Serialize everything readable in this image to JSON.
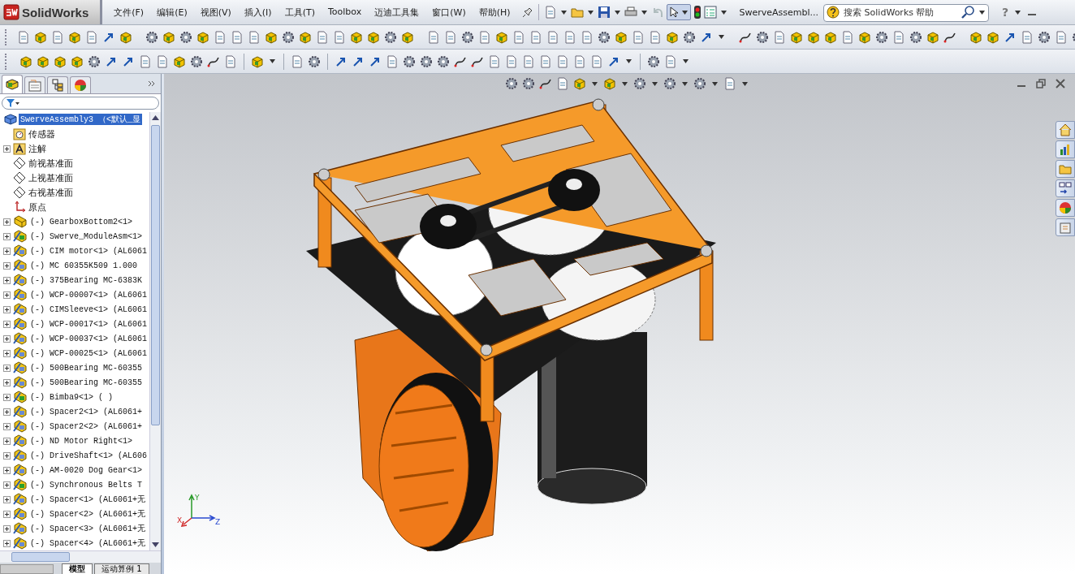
{
  "app": {
    "name": "SolidWorks"
  },
  "menu": [
    "文件(F)",
    "编辑(E)",
    "视图(V)",
    "插入(I)",
    "工具(T)",
    "Toolbox",
    "迈迪工具集",
    "窗口(W)",
    "帮助(H)"
  ],
  "document_title": "SwerveAssembl...",
  "search": {
    "placeholder": "搜索 SolidWorks 帮助"
  },
  "help_button": "?",
  "tree": {
    "root": {
      "label": "SwerveAssembly3 （<默认_显",
      "selected": true
    },
    "items": [
      {
        "label": "传感器",
        "kind": "sensor",
        "expandable": false
      },
      {
        "label": "注解",
        "kind": "annotation",
        "expandable": true
      },
      {
        "label": "前视基准面",
        "kind": "plane",
        "expandable": false
      },
      {
        "label": "上视基准面",
        "kind": "plane",
        "expandable": false
      },
      {
        "label": "右视基准面",
        "kind": "plane",
        "expandable": false
      },
      {
        "label": "原点",
        "kind": "origin",
        "expandable": false
      },
      {
        "label": "(-) GearboxBottom2<1>",
        "kind": "part",
        "expandable": true
      },
      {
        "label": "(-) Swerve_ModuleAsm<1>",
        "kind": "assembly",
        "expandable": true
      },
      {
        "label": "(-) CIM motor<1> (AL6061",
        "kind": "subpart",
        "expandable": true
      },
      {
        "label": "(-) MC 60355K509 1.000",
        "kind": "subpart",
        "expandable": true
      },
      {
        "label": "(-) 375Bearing MC-6383K",
        "kind": "subpart",
        "expandable": true
      },
      {
        "label": "(-) WCP-00007<1> (AL6061",
        "kind": "subpart",
        "expandable": true
      },
      {
        "label": "(-) CIMSleeve<1> (AL6061",
        "kind": "subpart",
        "expandable": true
      },
      {
        "label": "(-) WCP-00017<1> (AL6061",
        "kind": "subpart",
        "expandable": true
      },
      {
        "label": "(-) WCP-00037<1> (AL6061",
        "kind": "subpart",
        "expandable": true
      },
      {
        "label": "(-) WCP-00025<1> (AL6061",
        "kind": "subpart",
        "expandable": true
      },
      {
        "label": "(-) 500Bearing MC-60355",
        "kind": "subpart",
        "expandable": true
      },
      {
        "label": "(-) 500Bearing MC-60355",
        "kind": "subpart",
        "expandable": true
      },
      {
        "label": "(-) Bimba9<1> ( )",
        "kind": "assembly",
        "expandable": true
      },
      {
        "label": "(-) Spacer2<1> (AL6061+",
        "kind": "subpart",
        "expandable": true
      },
      {
        "label": "(-) Spacer2<2> (AL6061+",
        "kind": "subpart",
        "expandable": true
      },
      {
        "label": "(-) ND Motor Right<1>",
        "kind": "subpart",
        "expandable": true
      },
      {
        "label": "(-) DriveShaft<1> (AL606",
        "kind": "subpart",
        "expandable": true
      },
      {
        "label": "(-) AM-0020 Dog Gear<1>",
        "kind": "subpart",
        "expandable": true
      },
      {
        "label": "(-) Synchronous Belts T",
        "kind": "assembly",
        "expandable": true
      },
      {
        "label": "(-) Spacer<1> (AL6061+无",
        "kind": "subpart",
        "expandable": true
      },
      {
        "label": "(-) Spacer<2> (AL6061+无",
        "kind": "subpart",
        "expandable": true
      },
      {
        "label": "(-) Spacer<3> (AL6061+无",
        "kind": "subpart",
        "expandable": true
      },
      {
        "label": "(-) Spacer<4> (AL6061+无",
        "kind": "subpart",
        "expandable": true
      }
    ]
  },
  "bottom_tabs": [
    {
      "label": "模型",
      "selected": true
    },
    {
      "label": "运动算例 1",
      "selected": false
    }
  ],
  "triad": {
    "x": "X",
    "y": "Y",
    "z": "Z"
  }
}
